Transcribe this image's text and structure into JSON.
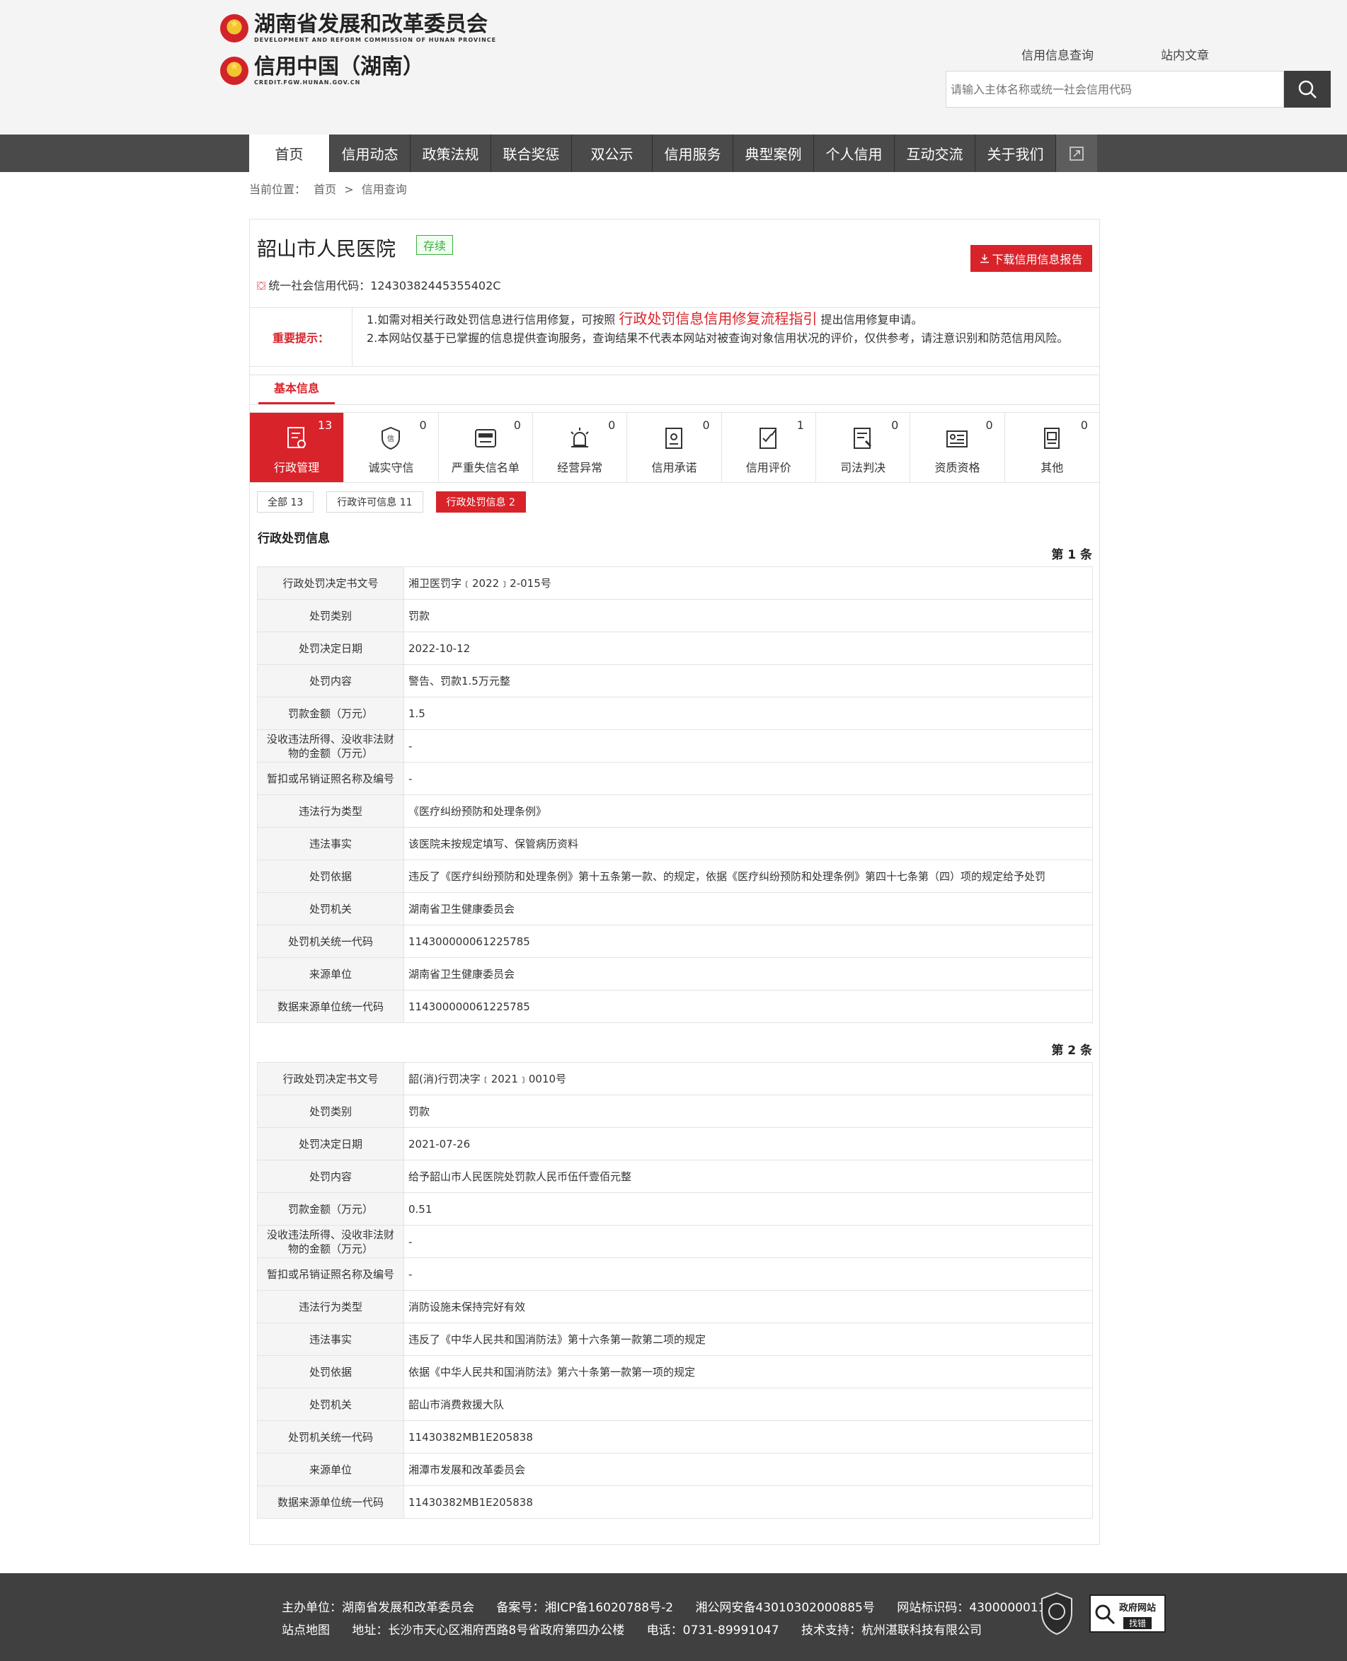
{
  "header": {
    "logo1_cn": "湖南省发展和改革委员会",
    "logo1_en": "DEVELOPMENT AND REFORM COMMISSION OF HUNAN PROVINCE",
    "logo2_cn": "信用中国（湖南）",
    "logo2_en": "CREDIT.FGW.HUNAN.GOV.CN",
    "search_tabs": [
      "信用信息查询",
      "站内文章"
    ],
    "search_placeholder": "请输入主体名称或统一社会信用代码"
  },
  "nav": {
    "items": [
      "首页",
      "信用动态",
      "政策法规",
      "联合奖惩",
      "双公示",
      "信用服务",
      "典型案例",
      "个人信用",
      "互动交流",
      "关于我们"
    ],
    "active_index": 0
  },
  "breadcrumb": {
    "prefix": "当前位置：",
    "home": "首页",
    "sep": ">",
    "current": "信用查询"
  },
  "entity": {
    "name": "韶山市人民医院",
    "status": "存续",
    "credit_code_label": "统一社会信用代码：",
    "credit_code": "12430382445355402C",
    "download_label": "下载信用信息报告"
  },
  "notice": {
    "label": "重要提示：",
    "line1_pre": "1.如需对相关行政处罚信息进行信用修复，可按照",
    "line1_link": "行政处罚信息信用修复流程指引",
    "line1_post": "提出信用修复申请。",
    "line2": "2.本网站仅基于已掌握的信息提供查询服务，查询结果不代表本网站对被查询对象信用状况的评价，仅供参考，请注意识别和防范信用风险。"
  },
  "basic_tab": "基本信息",
  "categories": [
    {
      "label": "行政管理",
      "count": "13"
    },
    {
      "label": "诚实守信",
      "count": "0"
    },
    {
      "label": "严重失信名单",
      "count": "0"
    },
    {
      "label": "经营异常",
      "count": "0"
    },
    {
      "label": "信用承诺",
      "count": "0"
    },
    {
      "label": "信用评价",
      "count": "1"
    },
    {
      "label": "司法判决",
      "count": "0"
    },
    {
      "label": "资质资格",
      "count": "0"
    },
    {
      "label": "其他",
      "count": "0"
    }
  ],
  "filters": [
    "全部 13",
    "行政许可信息 11",
    "行政处罚信息 2"
  ],
  "section_title": "行政处罚信息",
  "records": [
    {
      "no": "第 1 条",
      "rows": [
        [
          "行政处罚决定书文号",
          "湘卫医罚字﹝2022﹞2-015号"
        ],
        [
          "处罚类别",
          "罚款"
        ],
        [
          "处罚决定日期",
          "2022-10-12"
        ],
        [
          "处罚内容",
          "警告、罚款1.5万元整"
        ],
        [
          "罚款金额（万元）",
          "1.5"
        ],
        [
          "没收违法所得、没收非法财物的金额（万元）",
          "-"
        ],
        [
          "暂扣或吊销证照名称及编号",
          "-"
        ],
        [
          "违法行为类型",
          "《医疗纠纷预防和处理条例》"
        ],
        [
          "违法事实",
          "该医院未按规定填写、保管病历资料"
        ],
        [
          "处罚依据",
          "违反了《医疗纠纷预防和处理条例》第十五条第一款、的规定，依据《医疗纠纷预防和处理条例》第四十七条第（四）项的规定给予处罚"
        ],
        [
          "处罚机关",
          "湖南省卫生健康委员会"
        ],
        [
          "处罚机关统一代码",
          "114300000061225785"
        ],
        [
          "来源单位",
          "湖南省卫生健康委员会"
        ],
        [
          "数据来源单位统一代码",
          "114300000061225785"
        ]
      ]
    },
    {
      "no": "第 2 条",
      "rows": [
        [
          "行政处罚决定书文号",
          "韶(消)行罚决字﹝2021﹞0010号"
        ],
        [
          "处罚类别",
          "罚款"
        ],
        [
          "处罚决定日期",
          "2021-07-26"
        ],
        [
          "处罚内容",
          "给予韶山市人民医院处罚款人民币伍仟壹佰元整"
        ],
        [
          "罚款金额（万元）",
          "0.51"
        ],
        [
          "没收违法所得、没收非法财物的金额（万元）",
          "-"
        ],
        [
          "暂扣或吊销证照名称及编号",
          "-"
        ],
        [
          "违法行为类型",
          "消防设施未保持完好有效"
        ],
        [
          "违法事实",
          "违反了《中华人民共和国消防法》第十六条第一款第二项的规定"
        ],
        [
          "处罚依据",
          "依据《中华人民共和国消防法》第六十条第一款第一项的规定"
        ],
        [
          "处罚机关",
          "韶山市消费救援大队"
        ],
        [
          "处罚机关统一代码",
          "11430382MB1E205838"
        ],
        [
          "来源单位",
          "湘潭市发展和改革委员会"
        ],
        [
          "数据来源单位统一代码",
          "11430382MB1E205838"
        ]
      ]
    }
  ],
  "footer": {
    "line1": [
      "主办单位：湖南省发展和改革委员会",
      "备案号：湘ICP备16020788号-2",
      "湘公网安备43010302000885号",
      "网站标识码：4300000011"
    ],
    "line2": [
      "站点地图",
      "地址：长沙市天心区湘府西路8号省政府第四办公楼",
      "电话：0731-89991047",
      "技术支持：杭州湛联科技有限公司"
    ],
    "badge_text": "政府网站",
    "badge_sub": "找错"
  },
  "colors": {
    "accent": "#d9232a",
    "nav_bg": "#4a4a4a",
    "footer_bg": "#404040",
    "status_green": "#3bae40"
  }
}
